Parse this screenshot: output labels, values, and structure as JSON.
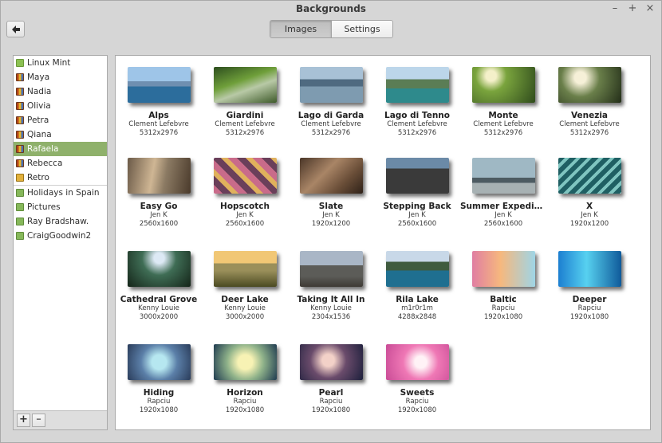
{
  "window": {
    "title": "Backgrounds"
  },
  "window_controls": {
    "minimize": "–",
    "maximize": "+",
    "close": "×"
  },
  "tabs": [
    {
      "label": "Images"
    },
    {
      "label": "Settings"
    }
  ],
  "sidebar": {
    "items": [
      {
        "label": "Linux Mint",
        "icon": "mint-icon"
      },
      {
        "label": "Maya",
        "icon": "books-icon"
      },
      {
        "label": "Nadia",
        "icon": "books-icon"
      },
      {
        "label": "Olivia",
        "icon": "books-icon"
      },
      {
        "label": "Petra",
        "icon": "books-icon"
      },
      {
        "label": "Qiana",
        "icon": "books-icon"
      },
      {
        "label": "Rafaela",
        "icon": "books-icon",
        "selected": true
      },
      {
        "label": "Rebecca",
        "icon": "books-icon"
      },
      {
        "label": "Retro",
        "icon": "retro-icon"
      },
      {
        "label": "Holidays in Spain",
        "icon": "folder-icon"
      },
      {
        "label": "Pictures",
        "icon": "pictures-icon"
      },
      {
        "label": "Ray Bradshaw.",
        "icon": "folder-icon"
      },
      {
        "label": "CraigGoodwin2",
        "icon": "folder-icon"
      }
    ],
    "add_label": "+",
    "remove_label": "–"
  },
  "images": [
    {
      "name": "Alps",
      "author": "Clement Lefebvre",
      "size": "5312x2976"
    },
    {
      "name": "Giardini",
      "author": "Clement Lefebvre",
      "size": "5312x2976"
    },
    {
      "name": "Lago di Garda",
      "author": "Clement Lefebvre",
      "size": "5312x2976"
    },
    {
      "name": "Lago di Tenno",
      "author": "Clement Lefebvre",
      "size": "5312x2976"
    },
    {
      "name": "Monte",
      "author": "Clement Lefebvre",
      "size": "5312x2976"
    },
    {
      "name": "Venezia",
      "author": "Clement Lefebvre",
      "size": "5312x2976"
    },
    {
      "name": "Easy Go",
      "author": "Jen K",
      "size": "2560x1600"
    },
    {
      "name": "Hopscotch",
      "author": "Jen K",
      "size": "2560x1600"
    },
    {
      "name": "Slate",
      "author": "Jen K",
      "size": "1920x1200"
    },
    {
      "name": "Stepping Back",
      "author": "Jen K",
      "size": "2560x1600"
    },
    {
      "name": "Summer Expediti…",
      "author": "Jen K",
      "size": "2560x1600"
    },
    {
      "name": "X",
      "author": "Jen K",
      "size": "1920x1200"
    },
    {
      "name": "Cathedral Grove",
      "author": "Kenny Louie",
      "size": "3000x2000"
    },
    {
      "name": "Deer Lake",
      "author": "Kenny Louie",
      "size": "3000x2000"
    },
    {
      "name": "Taking It All In",
      "author": "Kenny Louie",
      "size": "2304x1536"
    },
    {
      "name": "Rila Lake",
      "author": "m1r0r1m",
      "size": "4288x2848"
    },
    {
      "name": "Baltic",
      "author": "Rapciu",
      "size": "1920x1080"
    },
    {
      "name": "Deeper",
      "author": "Rapciu",
      "size": "1920x1080"
    },
    {
      "name": "Hiding",
      "author": "Rapciu",
      "size": "1920x1080"
    },
    {
      "name": "Horizon",
      "author": "Rapciu",
      "size": "1920x1080"
    },
    {
      "name": "Pearl",
      "author": "Rapciu",
      "size": "1920x1080"
    },
    {
      "name": "Sweets",
      "author": "Rapciu",
      "size": "1920x1080"
    }
  ],
  "colors": {
    "selection": "#8fb16b",
    "window_bg": "#d6d6d6"
  }
}
